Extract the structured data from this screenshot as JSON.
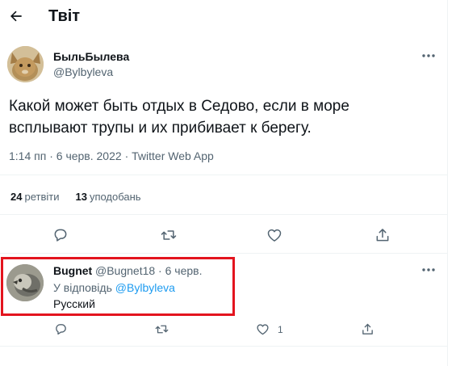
{
  "header": {
    "title": "Твіт"
  },
  "tweet": {
    "author_name": "БыльБылева",
    "author_handle": "@Bylbyleva",
    "text": "Какой может быть отдых в Седово, если в море всплывают трупы и их прибивает к берегу.",
    "time": "1:14 пп",
    "date": "6 черв. 2022",
    "source": "Twitter Web App",
    "separator": "·",
    "retweets_count": "24",
    "retweets_label": "ретвіти",
    "likes_count": "13",
    "likes_label": "уподобань"
  },
  "reply": {
    "author_name": "Bugnet",
    "author_handle": "@Bugnet18",
    "separator": "·",
    "date": "6 черв.",
    "replying_prefix": "У відповідь",
    "replying_to": "@Bylbyleva",
    "text": "Русский",
    "like_count": "1"
  },
  "icons": {
    "back": "arrow-left-icon",
    "more": "more-horizontal-icon",
    "reply": "comment-icon",
    "retweet": "retweet-icon",
    "like": "heart-icon",
    "share": "share-icon"
  },
  "colors": {
    "link": "#1d9bf0",
    "muted": "#536471",
    "highlight": "#e3141e"
  }
}
